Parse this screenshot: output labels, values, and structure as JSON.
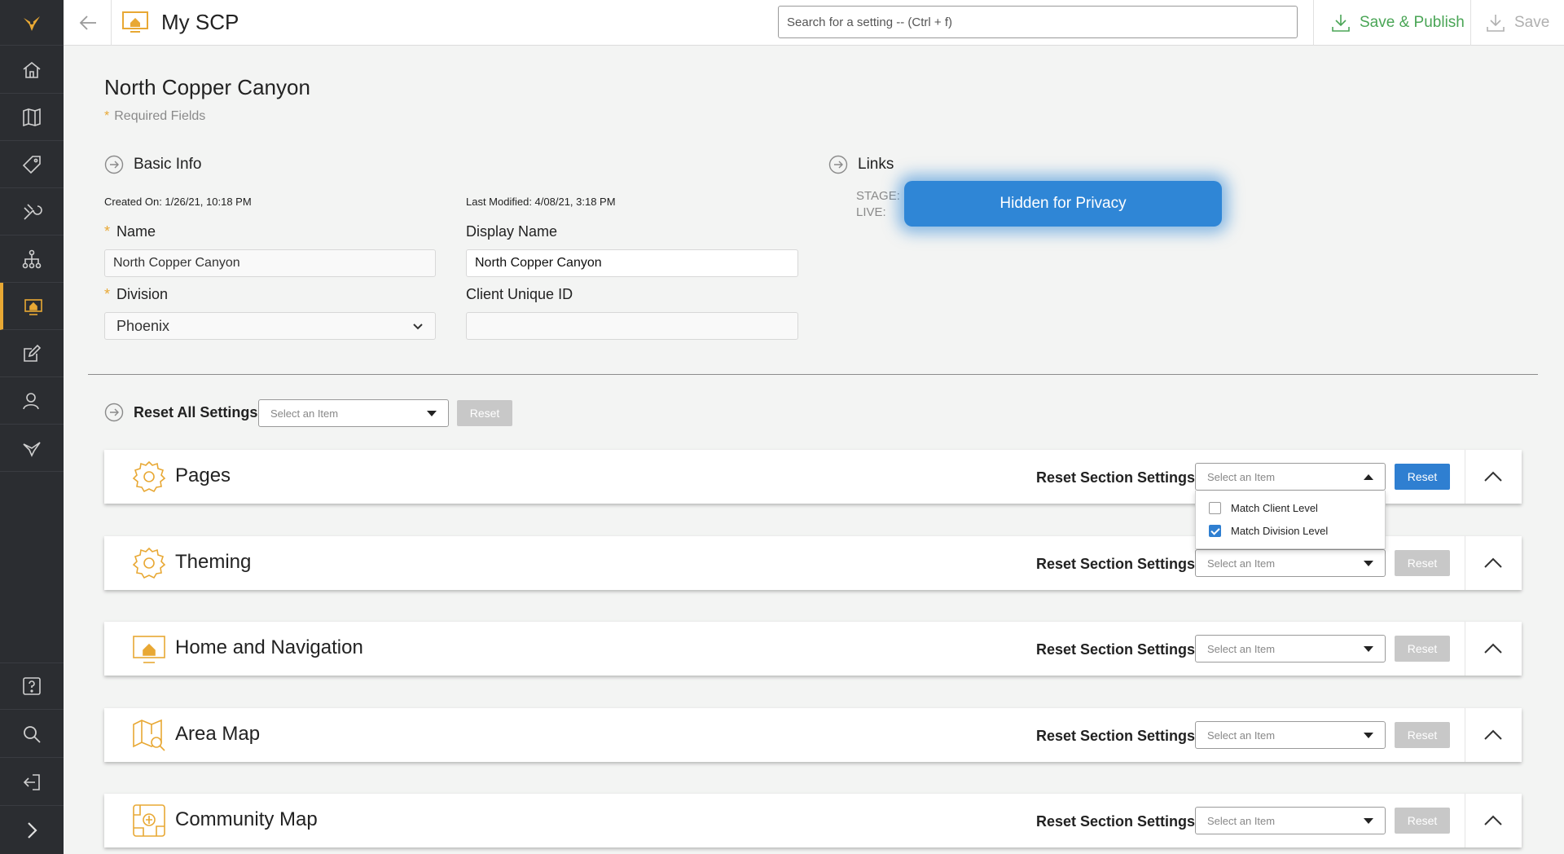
{
  "app": {
    "title": "My SCP"
  },
  "search": {
    "placeholder": "Search for a setting -- (Ctrl + f)"
  },
  "toolbar": {
    "publish_label": "Save & Publish",
    "save_label": "Save"
  },
  "page": {
    "title": "North Copper Canyon",
    "required_note": "Required Fields",
    "required_star": "*"
  },
  "basic_info": {
    "heading": "Basic Info",
    "created": "Created On: 1/26/21, 10:18 PM",
    "modified": "Last Modified: 4/08/21, 3:18 PM",
    "name_label": "Name",
    "name_value": "North Copper Canyon",
    "display_name_label": "Display Name",
    "display_name_value": "North Copper Canyon",
    "division_label": "Division",
    "division_value": "Phoenix",
    "client_id_label": "Client Unique ID",
    "client_id_value": ""
  },
  "links": {
    "heading": "Links",
    "stage_label": "STAGE:",
    "live_label": "LIVE:",
    "privacy_overlay": "Hidden for Privacy"
  },
  "reset_all": {
    "label": "Reset All Settings:",
    "placeholder": "Select an Item",
    "button": "Reset"
  },
  "sections": [
    {
      "title": "Pages",
      "reset_label": "Reset Section Settings:",
      "placeholder": "Select an Item",
      "button": "Reset"
    },
    {
      "title": "Theming",
      "reset_label": "Reset Section Settings:",
      "placeholder": "Select an Item",
      "button": "Reset"
    },
    {
      "title": "Home and Navigation",
      "reset_label": "Reset Section Settings:",
      "placeholder": "Select an Item",
      "button": "Reset"
    },
    {
      "title": "Area Map",
      "reset_label": "Reset Section Settings:",
      "placeholder": "Select an Item",
      "button": "Reset"
    },
    {
      "title": "Community Map",
      "reset_label": "Reset Section Settings:",
      "placeholder": "Select an Item",
      "button": "Reset"
    }
  ],
  "dropdown_options": [
    {
      "label": "Match Client Level",
      "checked": false
    },
    {
      "label": "Match Division Level",
      "checked": true
    }
  ],
  "colors": {
    "sidebar_bg": "#2b2d31",
    "accent": "#e8a834",
    "publish_green": "#4aa556",
    "primary_blue": "#2f7fd1"
  },
  "icons": {
    "sidebar": [
      "logo-icon",
      "home-icon",
      "map-icon",
      "tag-icon",
      "tools-icon",
      "org-chart-icon",
      "home-screen-icon",
      "edit-icon",
      "user-icon",
      "bird-icon",
      "help-icon",
      "search-icon",
      "logout-icon",
      "expand-icon"
    ]
  }
}
